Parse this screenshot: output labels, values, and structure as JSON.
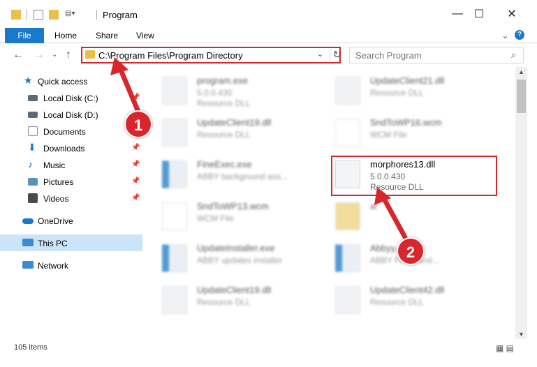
{
  "window": {
    "title": "Program"
  },
  "ribbon": {
    "file": "File",
    "home": "Home",
    "share": "Share",
    "view": "View",
    "help": "?"
  },
  "nav": {
    "path": "C:\\Program Files\\Program Directory",
    "search_placeholder": "Search Program"
  },
  "sidebar": {
    "items": [
      {
        "label": "Quick access",
        "icon": "star-icon",
        "color": "#1979ca"
      },
      {
        "label": "Local Disk (C:)",
        "icon": "drive-icon",
        "color": "#5a6b7d"
      },
      {
        "label": "Local Disk (D:)",
        "icon": "drive-icon",
        "color": "#5a6b7d"
      },
      {
        "label": "Documents",
        "icon": "documents-icon",
        "color": "#7d8a99"
      },
      {
        "label": "Downloads",
        "icon": "download-icon",
        "color": "#1979ca"
      },
      {
        "label": "Music",
        "icon": "music-icon",
        "color": "#1979ca"
      },
      {
        "label": "Pictures",
        "icon": "pictures-icon",
        "color": "#5a8fbf"
      },
      {
        "label": "Videos",
        "icon": "videos-icon",
        "color": "#4a4a4a"
      },
      {
        "label": "OneDrive",
        "icon": "cloud-icon",
        "color": "#1979ca"
      },
      {
        "label": "This PC",
        "icon": "computer-icon",
        "color": "#3c8ad6"
      },
      {
        "label": "Network",
        "icon": "network-icon",
        "color": "#3c8ad6"
      }
    ]
  },
  "files": [
    {
      "name": "program.exe",
      "line1": "5.0.0.430",
      "line2": "Resource DLL"
    },
    {
      "name": "UpdateClient21.dll",
      "line1": "Resource DLL",
      "line2": ""
    },
    {
      "name": "UpdateClient19.dll",
      "line1": "Resource DLL",
      "line2": ""
    },
    {
      "name": "SndToWP16.wcm",
      "line1": "WCM File",
      "line2": ""
    },
    {
      "name": "FineExec.exe",
      "line1": "ABBY background ass...",
      "line2": ""
    },
    {
      "name": "morphores13.dll",
      "line1": "5.0.0.430",
      "line2": "Resource DLL"
    },
    {
      "name": "SndToWP13.wcm",
      "line1": "WCM File",
      "line2": ""
    },
    {
      "name": "xl",
      "line1": "",
      "line2": ""
    },
    {
      "name": "UpdateInstaller.exe",
      "line1": "ABBY updates installer",
      "line2": ""
    },
    {
      "name": "Abbyy...",
      "line1": "ABBY Fine hand...",
      "line2": ""
    },
    {
      "name": "UpdateClient19.dll",
      "line1": "Resource DLL",
      "line2": ""
    },
    {
      "name": "UpdateClient42.dll",
      "line1": "Resource DLL",
      "line2": ""
    }
  ],
  "status": {
    "count": "105 items"
  },
  "annotations": {
    "step1": "1",
    "step2": "2",
    "color": "#d9262c"
  }
}
